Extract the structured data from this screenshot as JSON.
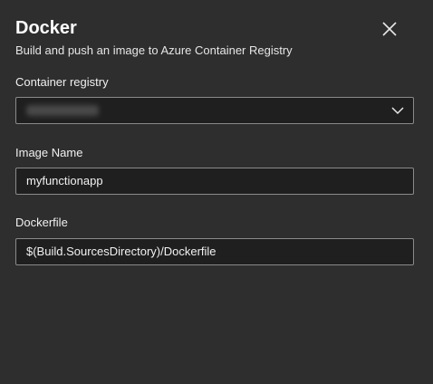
{
  "dialog": {
    "title": "Docker",
    "subtitle": "Build and push an image to Azure Container Registry",
    "close_icon": "close-icon"
  },
  "fields": {
    "container_registry": {
      "label": "Container registry",
      "value": "",
      "icon": "chevron-down-icon"
    },
    "image_name": {
      "label": "Image Name",
      "value": "myfunctionapp"
    },
    "dockerfile": {
      "label": "Dockerfile",
      "value": "$(Build.SourcesDirectory)/Dockerfile"
    }
  },
  "colors": {
    "background": "#2e2e2e",
    "input_background": "#1f1f1f",
    "input_border": "#8a8a8a",
    "text": "#ffffff"
  }
}
